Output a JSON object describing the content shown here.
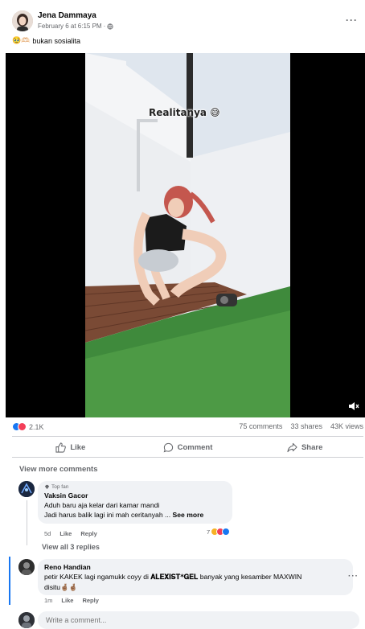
{
  "post": {
    "author": "Jena Dammaya",
    "date": "February 6 at 6:15 PM",
    "separator": "·",
    "caption_emojis": "🥹🫶🏻",
    "caption": "bukan sosialita",
    "more_label": "···"
  },
  "video": {
    "overlay_text": "Realitanya 😅"
  },
  "stats": {
    "reactions": "2.1K",
    "comments": "75 comments",
    "shares": "33 shares",
    "views": "43K views"
  },
  "actions": {
    "like": "Like",
    "comment": "Comment",
    "share": "Share"
  },
  "view_more_comments": "View more comments",
  "comments": [
    {
      "badge": "Top fan",
      "name": "Vaksin Gacor",
      "line1": "Aduh baru aja kelar dari kamar mandi",
      "line2": "Jadi harus balik lagi ini mah ceritanyah ...",
      "see_more": "See more",
      "time": "5d",
      "like": "Like",
      "reply": "Reply",
      "reaction_count": "7"
    },
    {
      "name": "Reno Handian",
      "text_a": "petir KAKEK lagi ngamukk coyy di ",
      "text_b": "𝐀𝐋𝐄𝐗𝐈𝐒𝐓*𝐆𝐄𝐋",
      "text_c": " banyak yang kesamber MAXWIN",
      "text_d": "disitu🤞🏽🤞🏽",
      "time": "1m",
      "like": "Like",
      "reply": "Reply",
      "more": "···"
    }
  ],
  "view_replies": "View all 3 replies",
  "write_comment": {
    "placeholder": "Write a comment..."
  },
  "colors": {
    "brand_blue": "#1877f2",
    "secondary_text": "#65676b",
    "bubble_bg": "#f0f2f5"
  }
}
